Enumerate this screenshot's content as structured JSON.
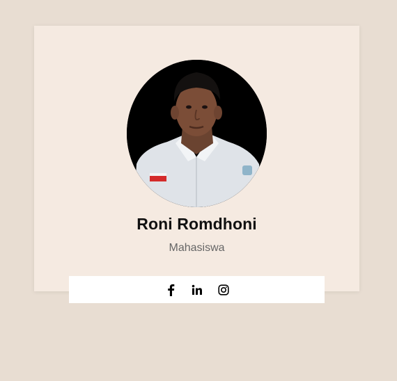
{
  "profile": {
    "name": "Roni Romdhoni",
    "role": "Mahasiswa",
    "photo_alt": "profile-photo"
  },
  "social": {
    "links": [
      {
        "icon": "facebook-icon",
        "label": "Facebook"
      },
      {
        "icon": "linkedin-icon",
        "label": "LinkedIn"
      },
      {
        "icon": "instagram-icon",
        "label": "Instagram"
      }
    ]
  },
  "colors": {
    "page_background": "#e8ddd2",
    "card_background": "#f5eae1",
    "social_bar_background": "#ffffff",
    "name_text": "#111111",
    "role_text": "#666666"
  }
}
